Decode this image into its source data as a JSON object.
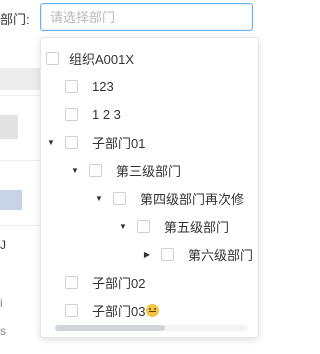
{
  "form": {
    "label": "部门:"
  },
  "select": {
    "placeholder": "请选择部门",
    "value": ""
  },
  "tree": [
    {
      "label": "组织A001X"
    },
    {
      "label": "123"
    },
    {
      "label": "1 2 3"
    },
    {
      "label": "子部门01",
      "expanded": true
    },
    {
      "label": "第三级部门",
      "expanded": true
    },
    {
      "label": "第四级部门再次修",
      "expanded": true
    },
    {
      "label": "第五级部门",
      "expanded": true
    },
    {
      "label": "第六级部门",
      "expanded": false
    },
    {
      "label": "子部门02"
    },
    {
      "label": "子部门03"
    }
  ],
  "background": {
    "side_letter": "J",
    "side_text_1": "i",
    "side_text_2": "s"
  },
  "colors": {
    "focus_border": "#66b1ff",
    "placeholder": "#b8b8b8"
  }
}
